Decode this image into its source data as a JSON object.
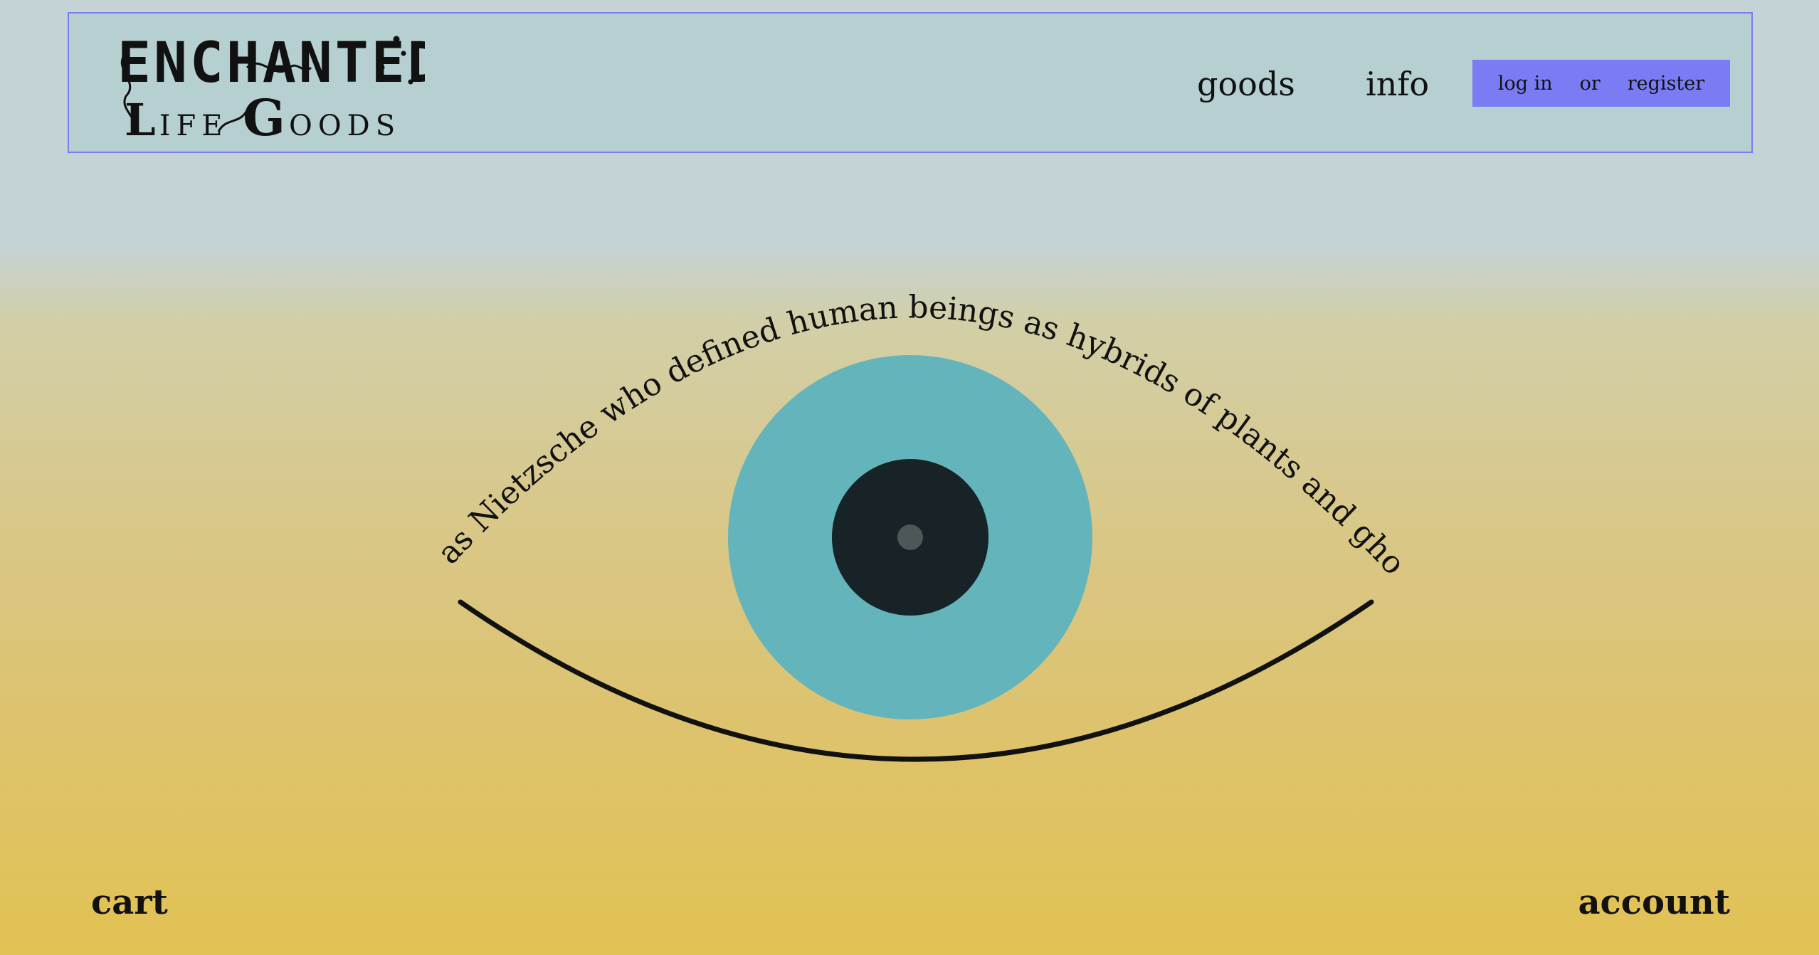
{
  "header": {
    "logo": {
      "line1": "ENCHANTED",
      "line2_first": "L",
      "line2_rest1": "IFE ",
      "line2_g": "G",
      "line2_rest2": "OODS"
    },
    "nav": {
      "goods_label": "goods",
      "info_label": "info"
    },
    "auth": {
      "login_label": "log in",
      "or_label": "or",
      "register_label": "register"
    }
  },
  "main": {
    "curved_quote": "it was Nietzsche who defined human beings as hybrids of plants and ghosts"
  },
  "footer": {
    "cart_label": "cart",
    "account_label": "account"
  },
  "colors": {
    "header_border": "#7a7cf0",
    "auth_bg": "#7b7cf4",
    "iris": "#64b4bb",
    "pupil": "#172326",
    "highlight": "#4c5757"
  }
}
